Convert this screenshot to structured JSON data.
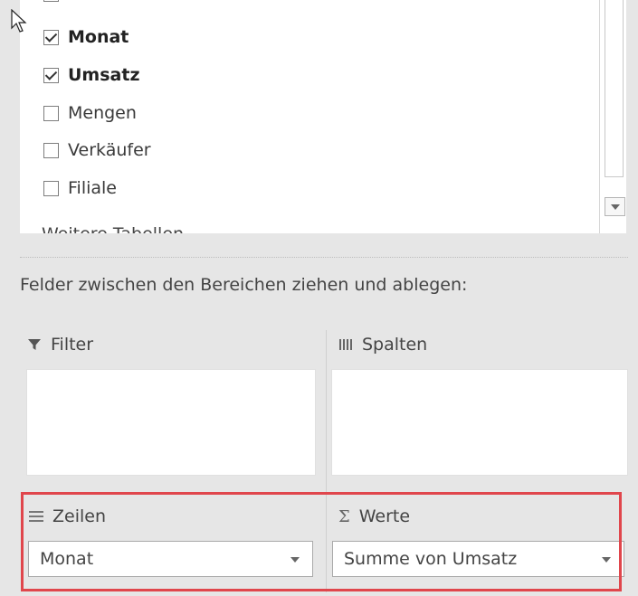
{
  "field_list": {
    "fields": [
      {
        "label": "Monat",
        "checked": true,
        "bold": true
      },
      {
        "label": "Umsatz",
        "checked": true,
        "bold": true
      },
      {
        "label": "Mengen",
        "checked": false,
        "bold": false
      },
      {
        "label": "Verkäufer",
        "checked": false,
        "bold": false
      },
      {
        "label": "Filiale",
        "checked": false,
        "bold": false
      }
    ],
    "more_tables": "Weitere Tabellen..."
  },
  "areas": {
    "instruction": "Felder zwischen den Bereichen ziehen und ablegen:",
    "filter": {
      "label": "Filter",
      "icon": "filter-icon"
    },
    "columns": {
      "label": "Spalten",
      "icon": "columns-icon"
    },
    "rows": {
      "label": "Zeilen",
      "icon": "rows-icon",
      "value": "Monat"
    },
    "values": {
      "label": "Werte",
      "icon": "sigma-icon",
      "value": "Summe von Umsatz"
    }
  },
  "colors": {
    "highlight": "#e0464c"
  }
}
